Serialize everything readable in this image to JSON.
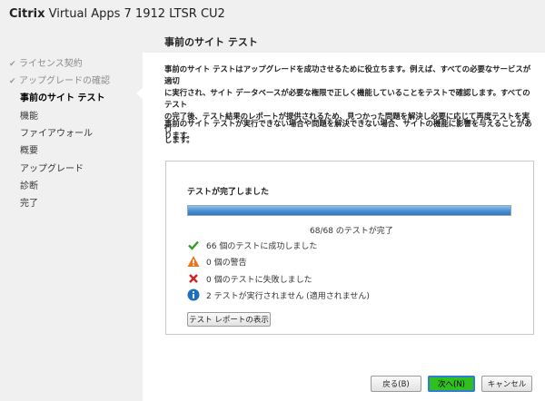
{
  "window": {
    "title_brand": "Citrix",
    "title_rest": "Virtual Apps 7 1912 LTSR CU2"
  },
  "sidebar": {
    "items": [
      {
        "label": "ライセンス契約",
        "state": "done"
      },
      {
        "label": "アップグレードの確認",
        "state": "done"
      },
      {
        "label": "事前のサイト テスト",
        "state": "current"
      },
      {
        "label": "機能",
        "state": "todo"
      },
      {
        "label": "ファイアウォール",
        "state": "todo"
      },
      {
        "label": "概要",
        "state": "todo"
      },
      {
        "label": "アップグレード",
        "state": "todo"
      },
      {
        "label": "診断",
        "state": "todo"
      },
      {
        "label": "完了",
        "state": "todo"
      }
    ]
  },
  "main": {
    "title": "事前のサイト テスト",
    "para1": [
      "事前のサイト テストはアップグレードを成功させるために役立ちます。例えば、すべての必要なサービスが適切",
      "に実行され、サイト データベースが必要な権限で正しく機能していることをテストで確認します。すべてのテスト",
      "の完了後、テスト結果のレポートが提供されるため、見つかった問題を解決し必要に応じて再度テストを実行",
      "します。"
    ],
    "para2": [
      "事前のサイト テストが実行できない場合や問題を解決できない場合、サイトの機能に影響を与えることがあ",
      "ります。"
    ],
    "status_heading": "テストが完了しました",
    "progress": {
      "fraction": 1.0,
      "text": "68/68 のテストが完了"
    },
    "results": [
      {
        "icon": "check-icon",
        "text": "66 個のテストに成功しました"
      },
      {
        "icon": "warning-icon",
        "text": "0 個の警告"
      },
      {
        "icon": "error-icon",
        "text": "0 個のテストに失敗しました"
      },
      {
        "icon": "info-icon",
        "text": "2 テストが実行されません (適用されません)"
      }
    ],
    "report_button": "テスト レポートの表示"
  },
  "buttons": {
    "back": "戻る(B)",
    "next": "次へ(N)",
    "cancel": "キャンセル"
  },
  "colors": {
    "check": "#3a9a2a",
    "warning": "#e8731e",
    "error": "#d42020",
    "info": "#1f6fc0",
    "next_button": "#2fbf1f"
  }
}
